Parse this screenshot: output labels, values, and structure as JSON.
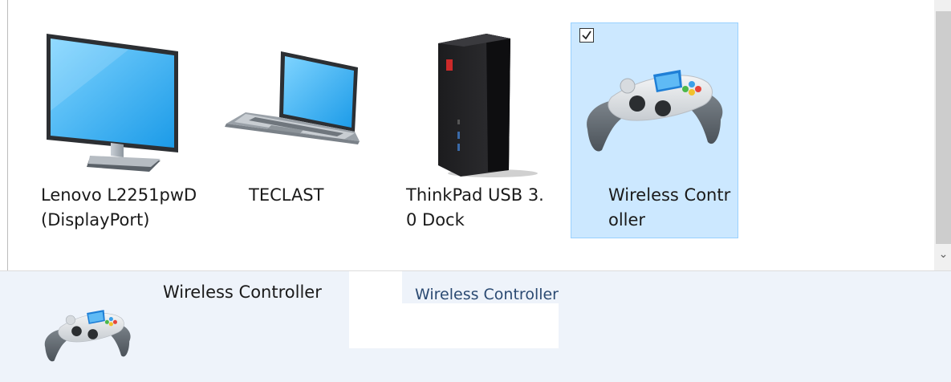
{
  "devices": [
    {
      "label": "Lenovo L2251pwD(DisplayPort)",
      "icon": "monitor-icon",
      "selected": false
    },
    {
      "label": "TECLAST",
      "icon": "laptop-icon",
      "selected": false
    },
    {
      "label": "ThinkPad USB 3.0 Dock",
      "icon": "dock-icon",
      "selected": false
    },
    {
      "label": "Wireless Controller",
      "icon": "gamepad-icon",
      "selected": true
    }
  ],
  "details": {
    "name": "Wireless Controller",
    "model": "Wireless Controller",
    "icon": "gamepad-icon"
  },
  "scrollbar": {
    "down_arrow": "⌄"
  },
  "colors": {
    "selection_bg": "#cce8ff",
    "selection_border": "#99d1ff",
    "details_bg": "#eef3fa",
    "details_link": "#2b4a72"
  }
}
